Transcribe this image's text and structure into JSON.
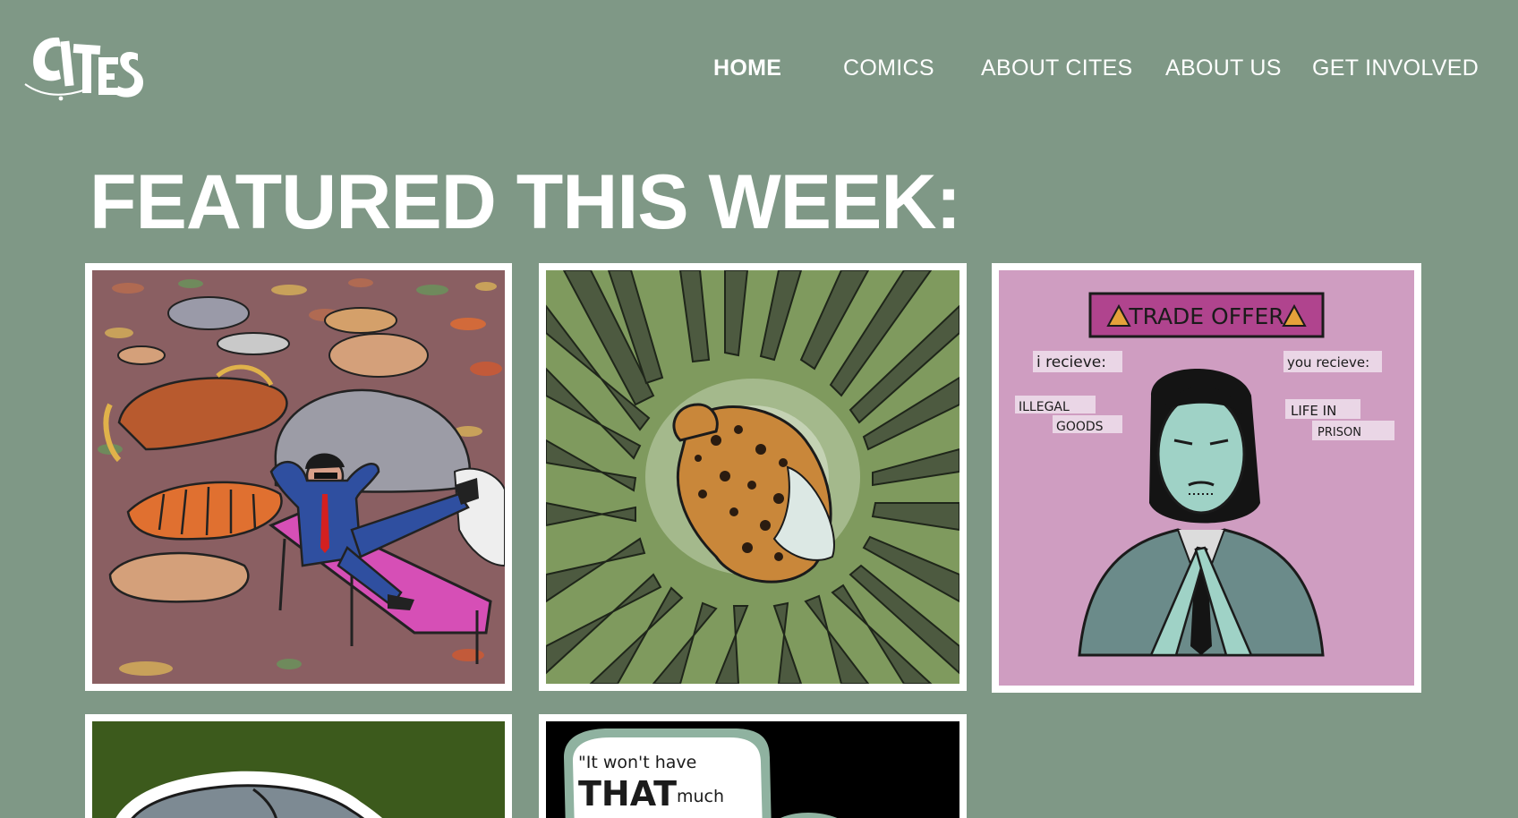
{
  "header": {
    "logo_text": "CITES",
    "nav": [
      {
        "label": "HOME",
        "active": true
      },
      {
        "label": "COMICS",
        "active": false
      },
      {
        "label": "ABOUT CITES",
        "active": false
      },
      {
        "label": "ABOUT US",
        "active": false
      },
      {
        "label": "GET INVOLVED",
        "active": false
      }
    ]
  },
  "main": {
    "title": "FEATURED THIS WEEK:",
    "comics": [
      {
        "description_icon": "businessman-on-lounger-amid-dead-animals-comic"
      },
      {
        "description_icon": "leopard-surrounded-by-weapons-comic"
      },
      {
        "description_icon": "trade-offer-meme-comic",
        "banner": "TRADE OFFER",
        "left_heading": "i recieve:",
        "left_item_line1": "ILLEGAL",
        "left_item_line2": "GOODS",
        "right_heading": "you recieve:",
        "right_item_line1": "LIFE IN",
        "right_item_line2": "PRISON"
      },
      {
        "description_icon": "elephant-on-green-comic"
      },
      {
        "description_icon": "speech-bubble-comic",
        "quote_line1": "\"It won't have",
        "quote_word_bold": "THAT",
        "quote_word_small": "much"
      }
    ]
  },
  "colors": {
    "background": "#7f9886",
    "card_border": "#ffffff",
    "text": "#ffffff"
  }
}
